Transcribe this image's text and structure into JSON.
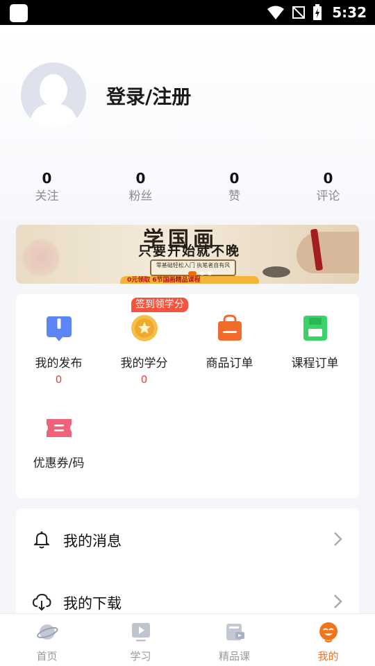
{
  "status_bar": {
    "time": "5:32"
  },
  "profile": {
    "login_label": "登录/注册"
  },
  "stats": [
    {
      "count": "0",
      "label": "关注"
    },
    {
      "count": "0",
      "label": "粉丝"
    },
    {
      "count": "0",
      "label": "赞"
    },
    {
      "count": "0",
      "label": "评论"
    }
  ],
  "banner": {
    "title": "学国画",
    "subtitle": "只要开始就不晚",
    "scroll_text": "零基础轻松入门 执笔者自有风",
    "promo_text": "0元领取 6节国画精品课程"
  },
  "menu": {
    "badge": "签到领学分",
    "items": [
      {
        "label": "我的发布",
        "count": "0",
        "icon": "publish-icon"
      },
      {
        "label": "我的学分",
        "count": "0",
        "icon": "credit-coin-icon"
      },
      {
        "label": "商品订单",
        "icon": "shopping-bag-icon"
      },
      {
        "label": "课程订单",
        "icon": "course-save-icon"
      },
      {
        "label": "优惠券/码",
        "icon": "coupon-icon"
      }
    ]
  },
  "list": [
    {
      "label": "我的消息",
      "icon": "bell-icon"
    },
    {
      "label": "我的下载",
      "icon": "cloud-download-icon"
    }
  ],
  "tabs": [
    {
      "label": "首页",
      "icon": "planet-icon"
    },
    {
      "label": "学习",
      "icon": "play-video-icon"
    },
    {
      "label": "精品课",
      "icon": "course-card-icon"
    },
    {
      "label": "我的",
      "icon": "profile-face-icon",
      "active": true
    }
  ],
  "colors": {
    "accent": "#f3751a",
    "count_red": "#e5413a",
    "badge_red": "#f5543e"
  }
}
